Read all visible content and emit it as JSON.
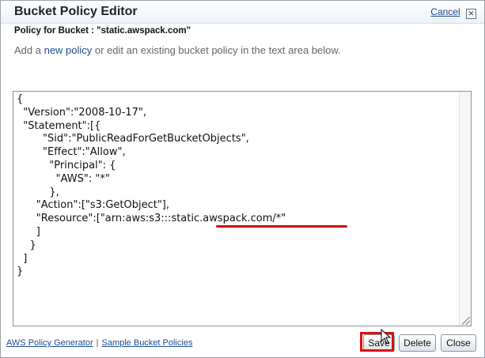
{
  "dialog": {
    "title": "Bucket Policy Editor",
    "cancel_label": "Cancel",
    "close_glyph": "✕",
    "policy_for_label": "Policy for Bucket : \"static.awspack.com\"",
    "instructions": {
      "prefix": "Add a ",
      "link": "new policy",
      "suffix": " or edit an existing bucket policy in the text area below."
    }
  },
  "editor": {
    "lines": [
      "{",
      "  \"Version\":\"2008-10-17\",",
      "  \"Statement\":[{",
      "        \"Sid\":\"PublicReadForGetBucketObjects\",",
      "        \"Effect\":\"Allow\",",
      "          \"Principal\": {",
      "            \"AWS\": \"*\"",
      "          },",
      "      \"Action\":[\"s3:GetObject\"],",
      "      \"Resource\":[\"arn:aws:s3:::static.awspack.com/*\"",
      "      ]",
      "    }",
      "  ]",
      "}"
    ]
  },
  "footer": {
    "links": [
      "AWS Policy Generator",
      "Sample Bucket Policies"
    ],
    "buttons": {
      "save": "Save",
      "delete": "Delete",
      "close": "Close"
    }
  },
  "colors": {
    "accent": "#1a4c8f",
    "highlight": "#e01010"
  }
}
